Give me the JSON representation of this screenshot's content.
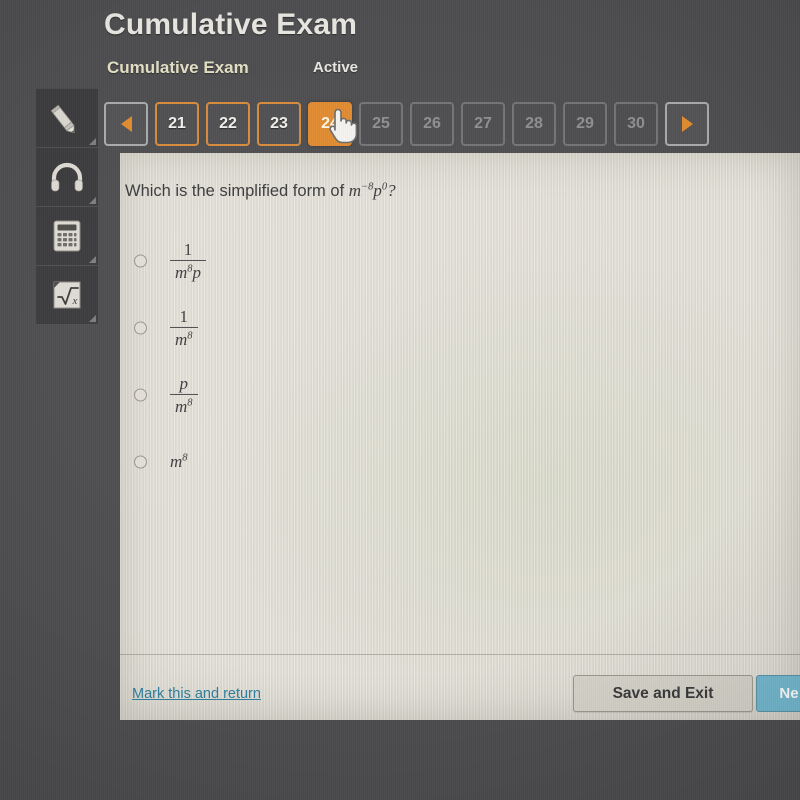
{
  "header": {
    "exam_title": "Cumulative Exam",
    "breadcrumb": "Cumulative Exam",
    "status": "Active"
  },
  "tools": [
    {
      "name": "pencil-tool",
      "icon": "pencil-icon"
    },
    {
      "name": "headphones-tool",
      "icon": "headphones-icon"
    },
    {
      "name": "calculator-tool",
      "icon": "calculator-icon"
    },
    {
      "name": "formula-tool",
      "icon": "square-root-icon"
    }
  ],
  "question_nav": {
    "prev_label": "◀",
    "next_label": "▶",
    "items": [
      {
        "label": "21",
        "state": "answered"
      },
      {
        "label": "22",
        "state": "answered"
      },
      {
        "label": "23",
        "state": "answered"
      },
      {
        "label": "24",
        "state": "current"
      },
      {
        "label": "25",
        "state": "locked"
      },
      {
        "label": "26",
        "state": "locked"
      },
      {
        "label": "27",
        "state": "locked"
      },
      {
        "label": "28",
        "state": "locked"
      },
      {
        "label": "29",
        "state": "locked"
      },
      {
        "label": "30",
        "state": "locked"
      }
    ]
  },
  "question": {
    "prompt_prefix": "Which is the simplified form of ",
    "expression": {
      "base1": "m",
      "exp1": "−8",
      "base2": "p",
      "exp2": "0",
      "suffix": "?"
    }
  },
  "options": [
    {
      "id": "option-a",
      "type": "fraction",
      "numerator": "1",
      "denominator_base": "m",
      "denominator_exp": "8",
      "denominator_tail": "p",
      "selected": false
    },
    {
      "id": "option-b",
      "type": "fraction",
      "numerator": "1",
      "denominator_base": "m",
      "denominator_exp": "8",
      "denominator_tail": "",
      "selected": false
    },
    {
      "id": "option-c",
      "type": "fraction",
      "numerator": "p",
      "denominator_base": "m",
      "denominator_exp": "8",
      "denominator_tail": "",
      "selected": false
    },
    {
      "id": "option-d",
      "type": "plain",
      "base": "m",
      "exp": "8",
      "selected": false
    }
  ],
  "footer": {
    "mark_return_label": "Mark this and return",
    "save_exit_label": "Save and Exit",
    "next_label": "Ne"
  },
  "colors": {
    "accent_orange": "#e08a2e",
    "link_blue": "#2f7f9e",
    "next_blue": "#74b8d0",
    "page_background": "#4d4d4f",
    "panel_background": "#dedbd2"
  },
  "cursor": {
    "name": "hand-pointer-cursor"
  }
}
